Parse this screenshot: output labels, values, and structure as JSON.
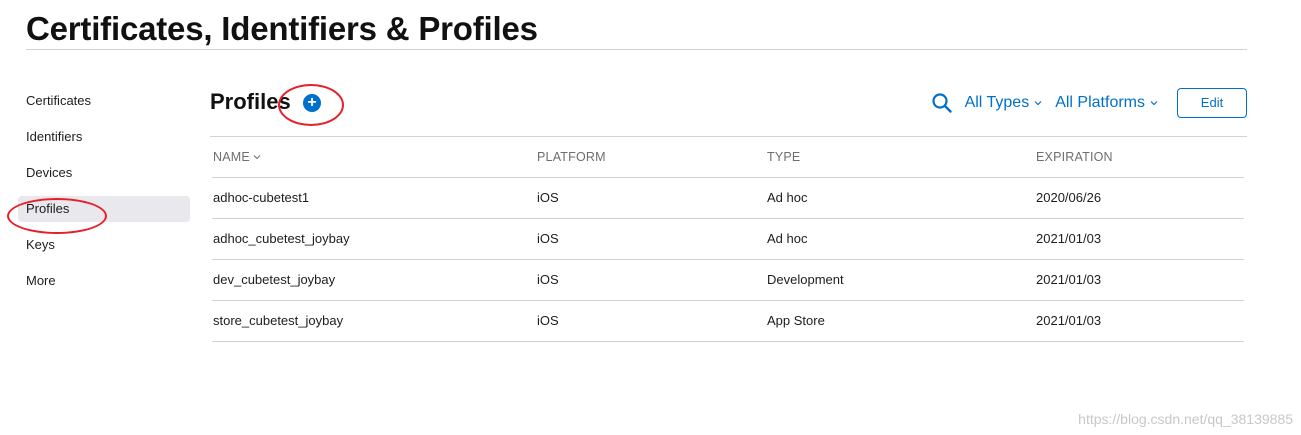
{
  "page": {
    "title": "Certificates, Identifiers & Profiles"
  },
  "sidebar": {
    "items": [
      {
        "label": "Certificates",
        "active": false
      },
      {
        "label": "Identifiers",
        "active": false
      },
      {
        "label": "Devices",
        "active": false
      },
      {
        "label": "Profiles",
        "active": true
      },
      {
        "label": "Keys",
        "active": false
      },
      {
        "label": "More",
        "active": false
      }
    ]
  },
  "main": {
    "section_title": "Profiles",
    "add_icon": "plus-circle-icon",
    "add_symbol": "+",
    "toolbar": {
      "search_icon": "search-icon",
      "type_filter": "All Types",
      "platform_filter": "All Platforms",
      "edit_label": "Edit"
    },
    "table": {
      "columns": {
        "name": "NAME",
        "platform": "PLATFORM",
        "type": "TYPE",
        "expiration": "EXPIRATION"
      },
      "rows": [
        {
          "name": "adhoc-cubetest1",
          "platform": "iOS",
          "type": "Ad hoc",
          "expiration": "2020/06/26"
        },
        {
          "name": "adhoc_cubetest_joybay",
          "platform": "iOS",
          "type": "Ad hoc",
          "expiration": "2021/01/03"
        },
        {
          "name": "dev_cubetest_joybay",
          "platform": "iOS",
          "type": "Development",
          "expiration": "2021/01/03"
        },
        {
          "name": "store_cubetest_joybay",
          "platform": "iOS",
          "type": "App Store",
          "expiration": "2021/01/03"
        }
      ]
    }
  },
  "watermark": "https://blog.csdn.net/qq_38139885",
  "colors": {
    "accent": "#0070c9",
    "annotation": "#e5202a",
    "active_item_bg": "#e8e8ed"
  }
}
